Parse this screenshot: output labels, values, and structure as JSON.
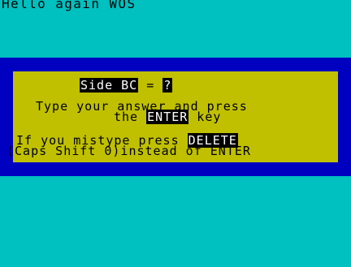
{
  "screen": {
    "greeting": "Hello again WOS"
  },
  "question": {
    "label": "Side BC",
    "equals": " = ",
    "answer": "?"
  },
  "instructions": {
    "line1": "Type your answer and press",
    "line2_prefix": "the ",
    "enter_key": "ENTER",
    "line2_suffix": " key",
    "line3_prefix": "If you mistype press ",
    "delete_key": "DELETE",
    "line4": "(Caps Shift 0)instead of ENTER"
  },
  "colors": {
    "background": "#00c0c0",
    "border": "#0000c0",
    "panel": "#c0c000",
    "text": "#000000",
    "inverse_text": "#ffffff"
  }
}
